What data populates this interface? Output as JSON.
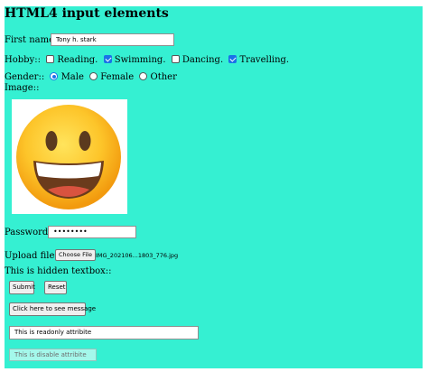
{
  "heading": "HTML4 input elements",
  "first_name": {
    "label": "First name::",
    "value": "Tony h. stark"
  },
  "hobby": {
    "label": "Hobby::",
    "options": [
      {
        "label": "Reading.",
        "checked": false
      },
      {
        "label": "Swimming.",
        "checked": true
      },
      {
        "label": "Dancing.",
        "checked": false
      },
      {
        "label": "Travelling.",
        "checked": true
      }
    ]
  },
  "gender": {
    "label": "Gender::",
    "options": [
      {
        "label": "Male",
        "selected": true
      },
      {
        "label": "Female",
        "selected": false
      },
      {
        "label": "Other",
        "selected": false
      }
    ]
  },
  "image": {
    "label": "Image::",
    "icon": "grinning-face-emoji"
  },
  "password": {
    "label": "Password::",
    "value": "••••••••"
  },
  "upload": {
    "label": "Upload file::",
    "button": "Choose File",
    "filename": "IMG_202106...1803_776.jpg"
  },
  "hidden_textbox": {
    "label": "This is hidden textbox::"
  },
  "buttons": {
    "submit": "Submit",
    "reset": "Reset",
    "message": "Click here to see message"
  },
  "readonly": {
    "value": "This is readonly attribite"
  },
  "disabled": {
    "value": "This is disable attribite"
  },
  "colors": {
    "page_bg": "#35f0d2",
    "checkbox_accent": "#1a73e8"
  }
}
